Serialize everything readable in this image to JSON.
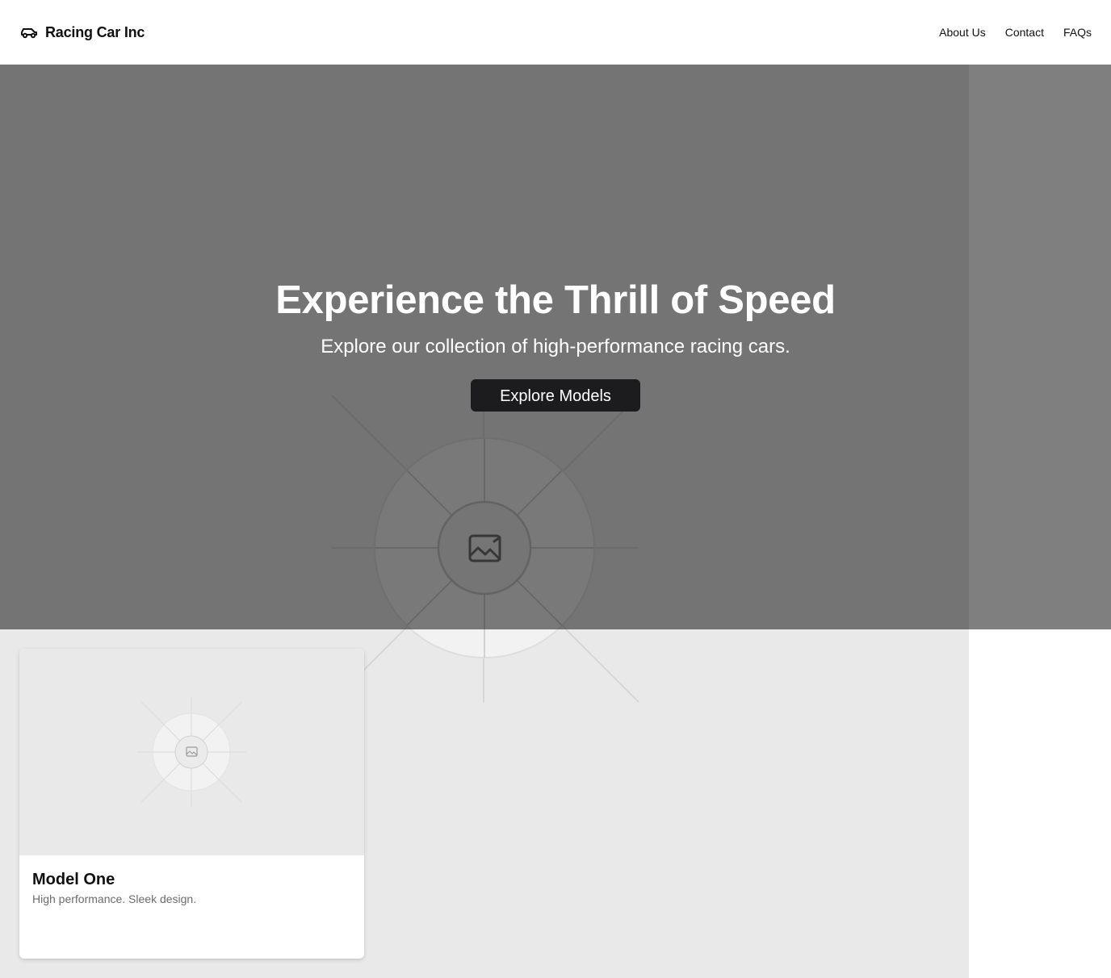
{
  "header": {
    "brand": {
      "name": "Racing Car Inc",
      "icon": "car-icon"
    },
    "nav": [
      {
        "label": "About Us"
      },
      {
        "label": "Contact"
      },
      {
        "label": "FAQs"
      }
    ]
  },
  "hero": {
    "title": "Experience the Thrill of Speed",
    "subtitle": "Explore our collection of high-performance racing cars.",
    "cta_label": "Explore Models",
    "overlay_color": "#000000",
    "button_color": "#1c1c1e"
  },
  "models": [
    {
      "title": "Model One",
      "description": "High performance. Sleek design.",
      "image_icon": "image-placeholder-icon"
    }
  ],
  "colors": {
    "page_background": "#ffffff",
    "placeholder_background": "#e9e9e9",
    "muted_text": "#6b6b6b"
  }
}
